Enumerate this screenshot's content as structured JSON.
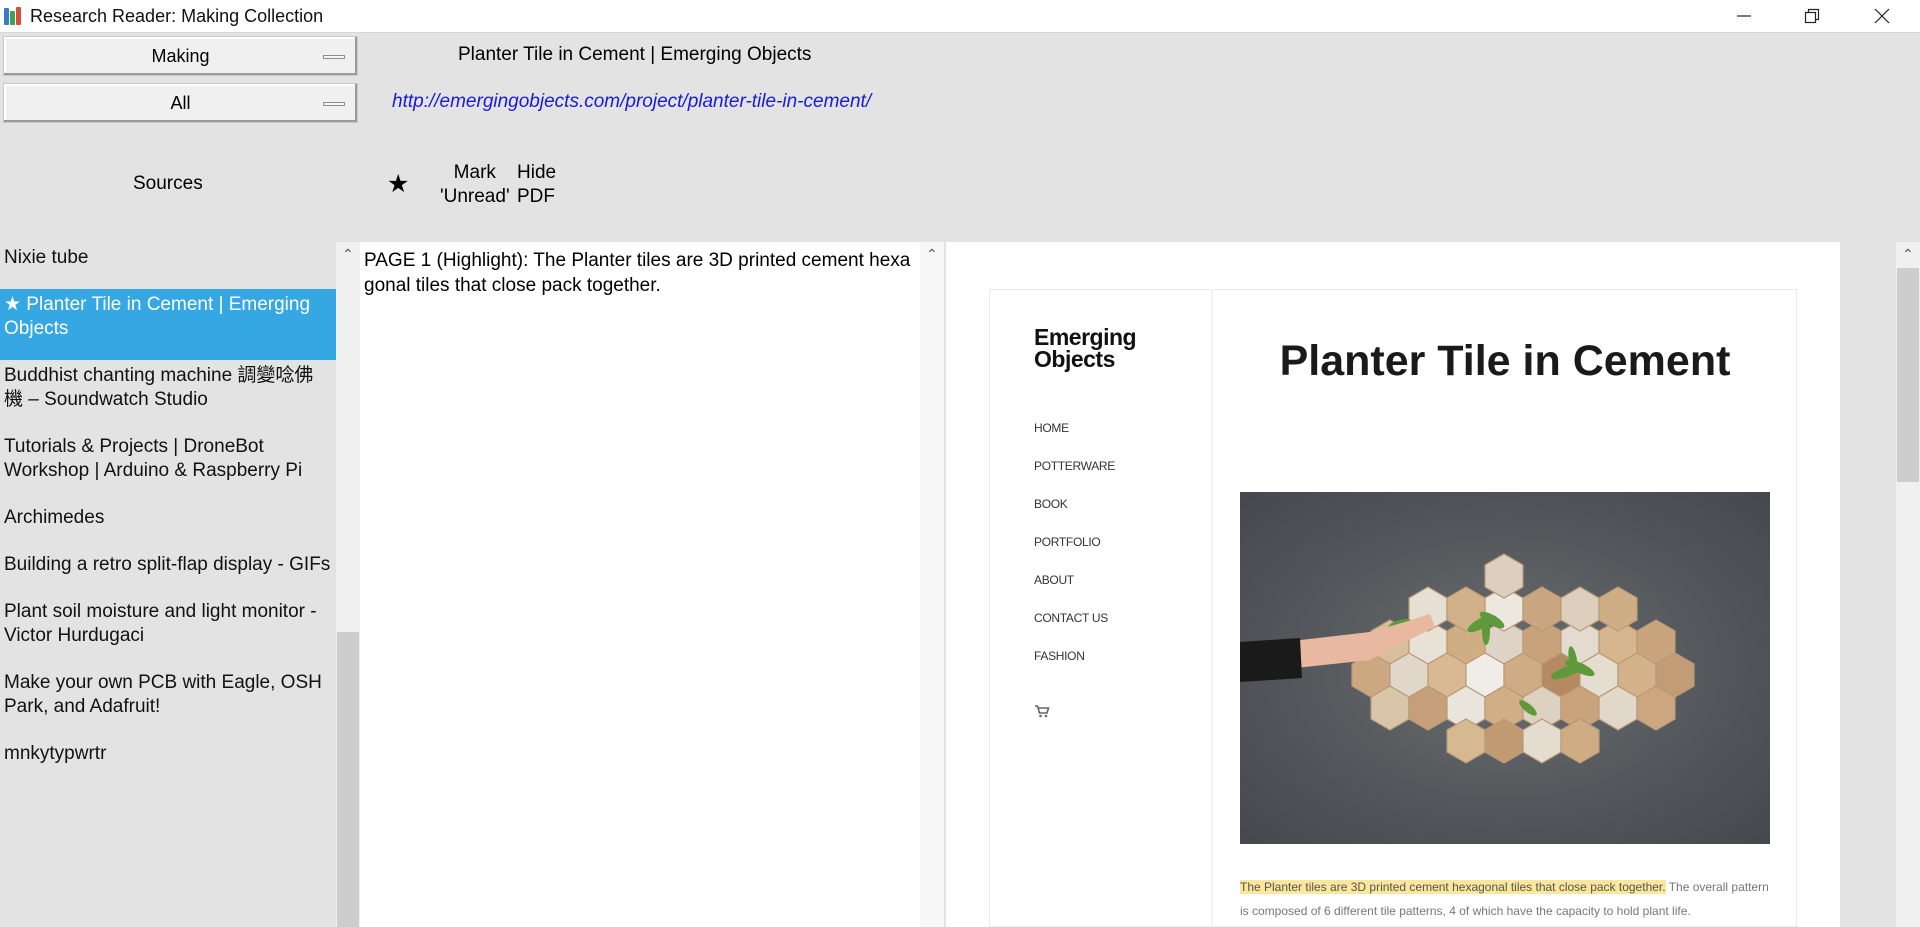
{
  "window": {
    "title": "Research Reader: Making Collection",
    "icon": "books-icon"
  },
  "controls": {
    "collection_select": "Making",
    "filter_select": "All",
    "sources_label": "Sources",
    "star_icon": "★",
    "mark_unread": [
      "Mark",
      "'Unread'"
    ],
    "hide_pdf": [
      "Hide",
      "PDF"
    ]
  },
  "document": {
    "title": "Planter Tile in Cement | Emerging Objects",
    "url": "http://emergingobjects.com/project/planter-tile-in-cement/"
  },
  "sources": [
    {
      "label": "Nixie tube"
    },
    {
      "label": "★ Planter Tile in Cement | Emerging Objects",
      "selected": true
    },
    {
      "label": "Buddhist chanting machine 調變唸佛機 – Soundwatch Studio"
    },
    {
      "label": "Tutorials & Projects | DroneBot Workshop | Arduino & Raspberry Pi"
    },
    {
      "label": "Archimedes"
    },
    {
      "label": "Building a retro split-flap display - GIFs"
    },
    {
      "label": "Plant soil moisture and light monitor - Victor Hurdugaci"
    },
    {
      "label": "Make your own PCB with Eagle, OSH Park, and Adafruit!"
    },
    {
      "label": "mnkytypwrtr"
    }
  ],
  "notes": {
    "text": "PAGE 1 (Highlight):  The Planter tiles are 3D printed cement hexagonal tiles that close pack together."
  },
  "pdf": {
    "logo": [
      "Emerging",
      "Objects"
    ],
    "nav": [
      "HOME",
      "POTTERWARE",
      "BOOK",
      "PORTFOLIO",
      "ABOUT",
      "CONTACT US",
      "FASHION"
    ],
    "heading": "Planter Tile in Cement",
    "highlight": "The Planter tiles are 3D printed cement hexagonal tiles that close pack together.",
    "body_rest": " The overall pattern is composed of 6 different tile patterns, 4 of which have the capacity to hold plant life."
  },
  "colors": {
    "selected_row": "#35a8e4",
    "url_link": "#1a1adb",
    "highlight": "#fbe79b"
  }
}
